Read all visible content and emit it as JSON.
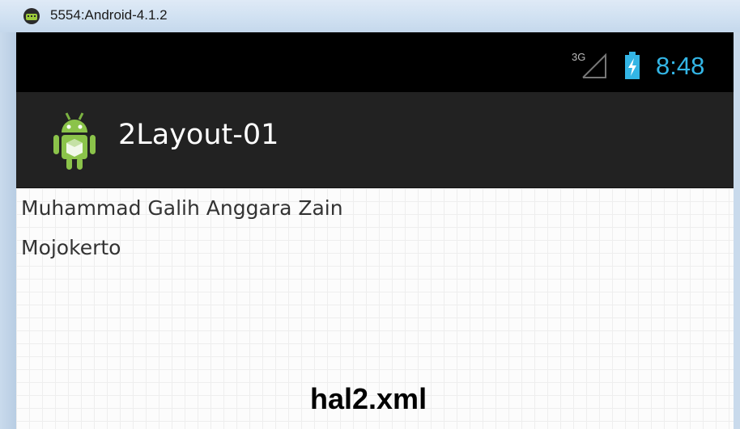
{
  "window": {
    "title": "5554:Android-4.1.2",
    "icon": "android-emulator-icon"
  },
  "status_bar": {
    "network": "3G",
    "clock": "8:48",
    "accent": "#33b5e5",
    "icons": [
      "signal-icon",
      "battery-icon"
    ]
  },
  "action_bar": {
    "app_icon": "android-robot-icon",
    "title": "2Layout-01"
  },
  "content": {
    "lines": [
      "Muhammad Galih Anggara Zain",
      "Mojokerto"
    ]
  },
  "caption": "hal2.xml"
}
